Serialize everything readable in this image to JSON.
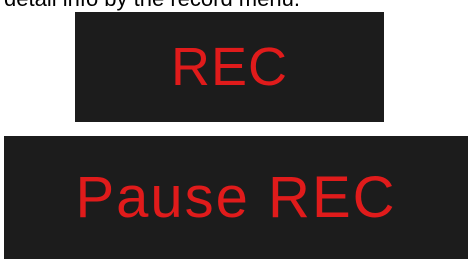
{
  "caption": {
    "text": "detail info by the record menu."
  },
  "panels": {
    "rec_label": "REC",
    "pause_rec_label": "Pause REC"
  },
  "colors": {
    "panel_background": "#1c1c1c",
    "indicator_text": "#e01b1b"
  }
}
